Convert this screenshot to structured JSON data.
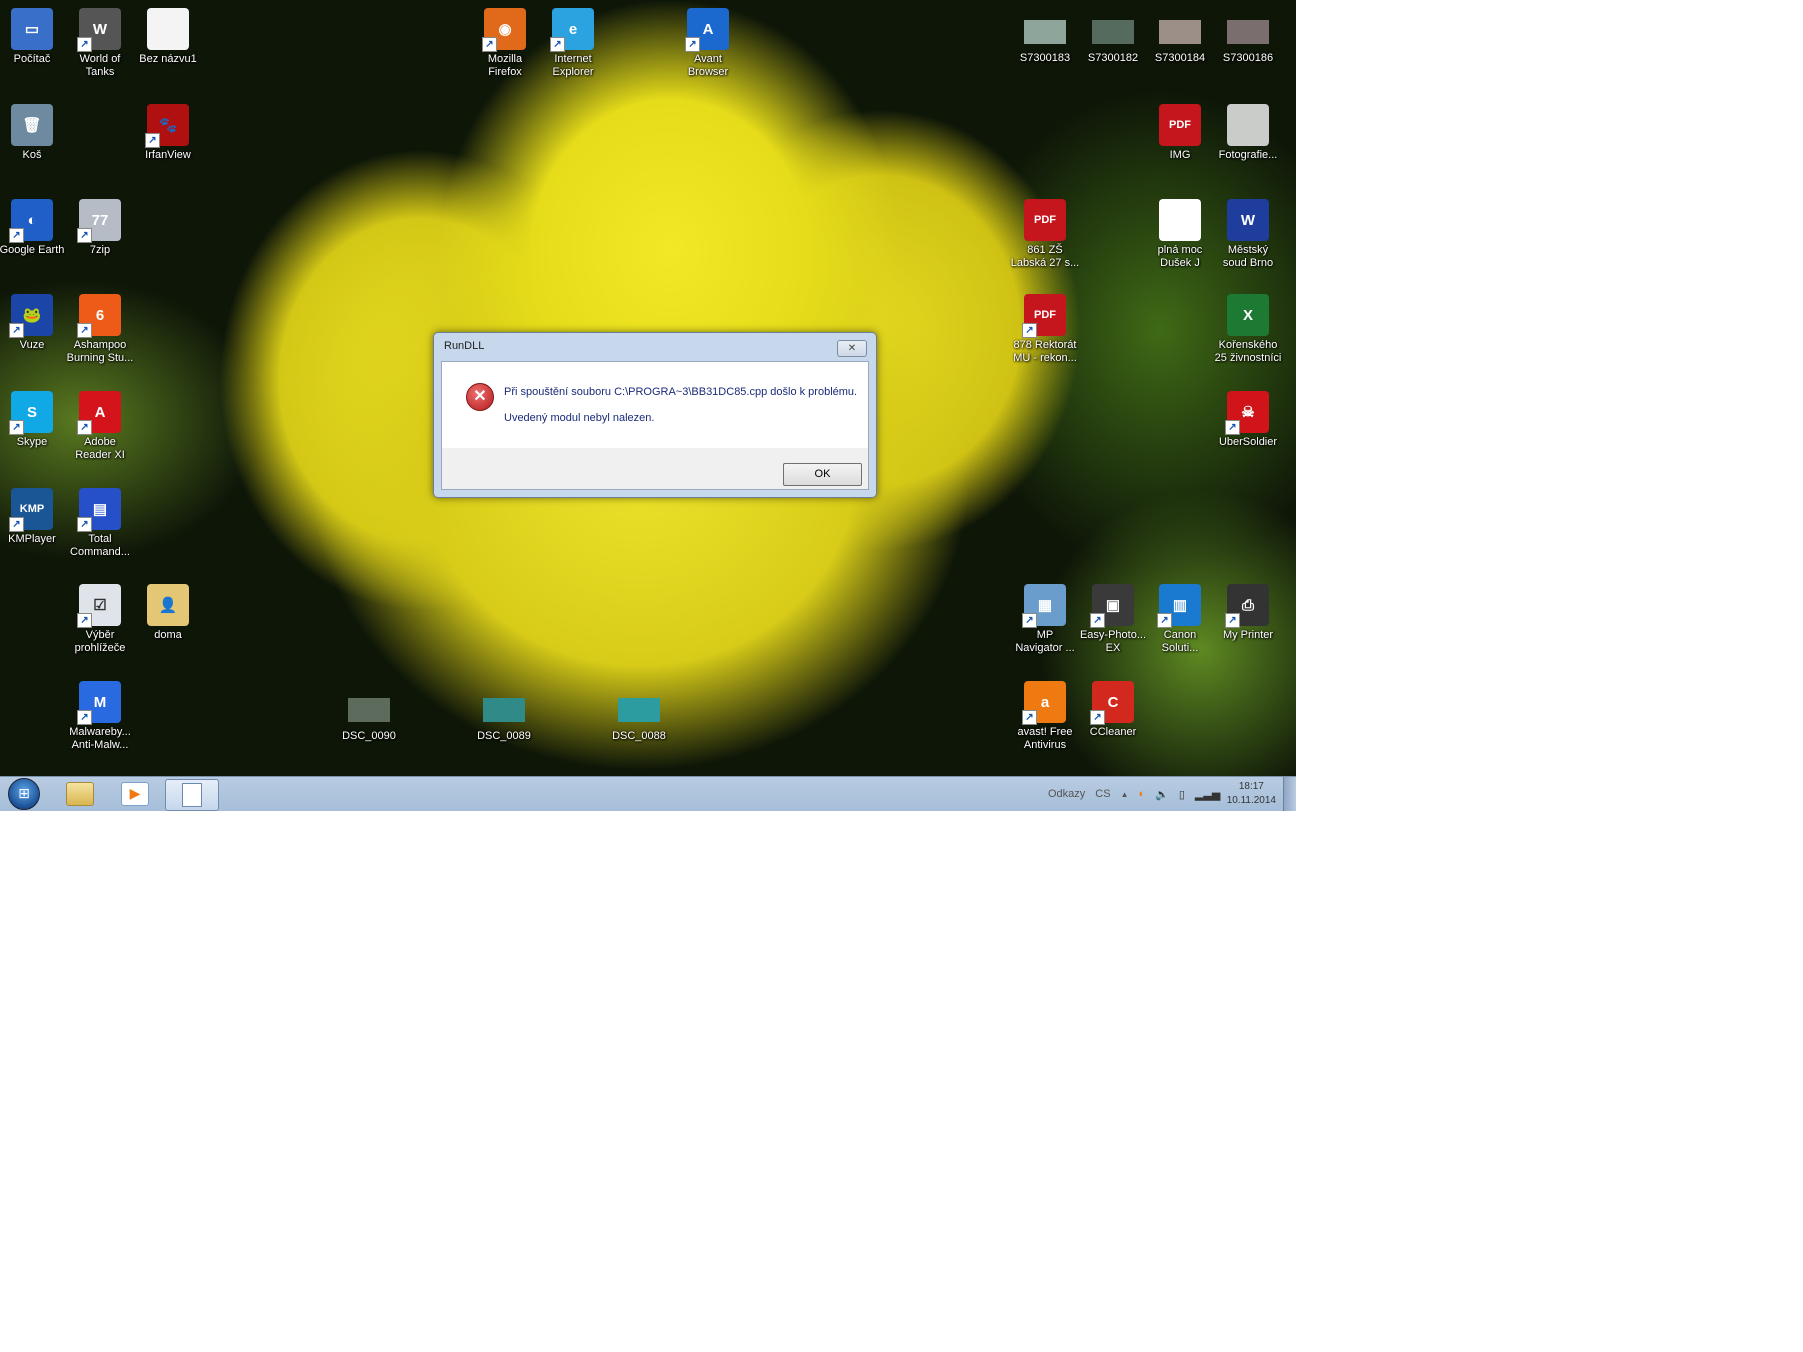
{
  "desktop": {
    "icons": [
      {
        "id": "pocitac",
        "label": [
          "Počítač"
        ],
        "glyph": "▭",
        "color": "#3a6fc9",
        "shortcut": false
      },
      {
        "id": "world-of-tanks",
        "label": [
          "World of",
          "Tanks"
        ],
        "glyph": "W",
        "color": "#555555",
        "shortcut": true
      },
      {
        "id": "bez-nazvu1",
        "label": [
          "Bez názvu1"
        ],
        "glyph": "",
        "color": "#f4f4f4",
        "shortcut": false
      },
      {
        "id": "kos",
        "label": [
          "Koš"
        ],
        "glyph": "🗑",
        "color": "#6d8aa0",
        "shortcut": false
      },
      {
        "id": "irfanview",
        "label": [
          "IrfanView"
        ],
        "glyph": "🐾",
        "color": "#b01010",
        "shortcut": true
      },
      {
        "id": "google-earth",
        "label": [
          "Google Earth"
        ],
        "glyph": "◐",
        "color": "#1f5fc7",
        "shortcut": true
      },
      {
        "id": "7zip",
        "label": [
          "7zip"
        ],
        "glyph": "77",
        "color": "#b6bcc6",
        "shortcut": true
      },
      {
        "id": "vuze",
        "label": [
          "Vuze"
        ],
        "glyph": "🐸",
        "color": "#1c45a8",
        "shortcut": true
      },
      {
        "id": "ashampoo",
        "label": [
          "Ashampoo",
          "Burning Stu..."
        ],
        "glyph": "6",
        "color": "#ee5a18",
        "shortcut": true
      },
      {
        "id": "skype",
        "label": [
          "Skype"
        ],
        "glyph": "S",
        "color": "#11a8e6",
        "shortcut": true
      },
      {
        "id": "adobe-reader",
        "label": [
          "Adobe",
          "Reader XI"
        ],
        "glyph": "A",
        "color": "#d4141a",
        "shortcut": true
      },
      {
        "id": "kmplayer",
        "label": [
          "KMPlayer"
        ],
        "glyph": "KMP",
        "color": "#1a5596",
        "shortcut": true
      },
      {
        "id": "total-commander",
        "label": [
          "Total",
          "Command..."
        ],
        "glyph": "▤",
        "color": "#2650c8",
        "shortcut": true
      },
      {
        "id": "vyber-prohlizece",
        "label": [
          "Výběr",
          "prohlížeče"
        ],
        "glyph": "☑",
        "color": "#dfe4ea",
        "shortcut": true
      },
      {
        "id": "doma",
        "label": [
          "doma"
        ],
        "glyph": "👤",
        "color": "#e3c774",
        "shortcut": false
      },
      {
        "id": "malwarebytes",
        "label": [
          "Malwareby...",
          "Anti-Malw..."
        ],
        "glyph": "M",
        "color": "#2a6ae0",
        "shortcut": true
      },
      {
        "id": "firefox",
        "label": [
          "Mozilla",
          "Firefox"
        ],
        "glyph": "◉",
        "color": "#e06a1a",
        "shortcut": true
      },
      {
        "id": "internet-explorer",
        "label": [
          "Internet",
          "Explorer"
        ],
        "glyph": "e",
        "color": "#2aa3e0",
        "shortcut": true
      },
      {
        "id": "avant-browser",
        "label": [
          "Avant",
          "Browser"
        ],
        "glyph": "A",
        "color": "#1b68cf",
        "shortcut": true
      },
      {
        "id": "s7300183",
        "label": [
          "S7300183"
        ],
        "glyph": "",
        "color": "#8da59a",
        "shortcut": false,
        "thumb": true
      },
      {
        "id": "s7300182",
        "label": [
          "S7300182"
        ],
        "glyph": "",
        "color": "#556b5e",
        "shortcut": false,
        "thumb": true
      },
      {
        "id": "s7300184",
        "label": [
          "S7300184"
        ],
        "glyph": "",
        "color": "#9c8f88",
        "shortcut": false,
        "thumb": true
      },
      {
        "id": "s7300186",
        "label": [
          "S7300186"
        ],
        "glyph": "",
        "color": "#7a6e6e",
        "shortcut": false,
        "thumb": true
      },
      {
        "id": "img",
        "label": [
          "IMG"
        ],
        "glyph": "PDF",
        "color": "#c4161c",
        "shortcut": false
      },
      {
        "id": "fotografie",
        "label": [
          "Fotografie..."
        ],
        "glyph": "",
        "color": "#c9ccc9",
        "shortcut": false
      },
      {
        "id": "861-zs",
        "label": [
          "861 ZŠ",
          "Labská 27 s..."
        ],
        "glyph": "PDF",
        "color": "#c4161c",
        "shortcut": false
      },
      {
        "id": "plna-moc",
        "label": [
          "plná moc",
          "Dušek J"
        ],
        "glyph": "",
        "color": "#ffffff",
        "shortcut": false
      },
      {
        "id": "mestsky-soud",
        "label": [
          "Městský",
          "soud Brno"
        ],
        "glyph": "W",
        "color": "#1f3d9c",
        "shortcut": false
      },
      {
        "id": "878-rektorat",
        "label": [
          "878 Rektorát",
          "MU - rekon..."
        ],
        "glyph": "PDF",
        "color": "#c4161c",
        "shortcut": true
      },
      {
        "id": "korenskeho",
        "label": [
          "Kořenského",
          "25 živnostníci"
        ],
        "glyph": "X",
        "color": "#1d7a32",
        "shortcut": false
      },
      {
        "id": "ubersoldier",
        "label": [
          "UberSoldier"
        ],
        "glyph": "☠",
        "color": "#d0141a",
        "shortcut": true
      },
      {
        "id": "mp-navigator",
        "label": [
          "MP",
          "Navigator ..."
        ],
        "glyph": "▦",
        "color": "#6a9ccc",
        "shortcut": true
      },
      {
        "id": "easy-photo-print",
        "label": [
          "Easy-Photo...",
          "EX"
        ],
        "glyph": "▣",
        "color": "#3a3a3a",
        "shortcut": true
      },
      {
        "id": "canon-solution",
        "label": [
          "Canon",
          "Soluti..."
        ],
        "glyph": "▥",
        "color": "#1a7ad0",
        "shortcut": true
      },
      {
        "id": "my-printer",
        "label": [
          "My Printer"
        ],
        "glyph": "⎙",
        "color": "#333333",
        "shortcut": true
      },
      {
        "id": "avast",
        "label": [
          "avast! Free",
          "Antivirus"
        ],
        "glyph": "a",
        "color": "#f07a12",
        "shortcut": true
      },
      {
        "id": "ccleaner",
        "label": [
          "CCleaner"
        ],
        "glyph": "C",
        "color": "#d2281e",
        "shortcut": true
      },
      {
        "id": "dsc-0090",
        "label": [
          "DSC_0090"
        ],
        "glyph": "",
        "color": "#5d6b5c",
        "shortcut": false,
        "thumb": true
      },
      {
        "id": "dsc-0089",
        "label": [
          "DSC_0089"
        ],
        "glyph": "",
        "color": "#2f8a88",
        "shortcut": false,
        "thumb": true
      },
      {
        "id": "dsc-0088",
        "label": [
          "DSC_0088"
        ],
        "glyph": "",
        "color": "#2c9ca0",
        "shortcut": false,
        "thumb": true
      }
    ]
  },
  "dialog": {
    "title": "RunDLL",
    "close_glyph": "✕",
    "message_line1": "Při spouštění souboru C:\\PROGRA~3\\BB31DC85.cpp došlo k problému.",
    "message_line2": "Uvedený modul nebyl nalezen.",
    "ok_label": "OK"
  },
  "taskbar": {
    "toolbar_label": "Odkazy",
    "language": "CS",
    "tray_expand": "▲",
    "time": "18:17",
    "date": "10.11.2014"
  }
}
